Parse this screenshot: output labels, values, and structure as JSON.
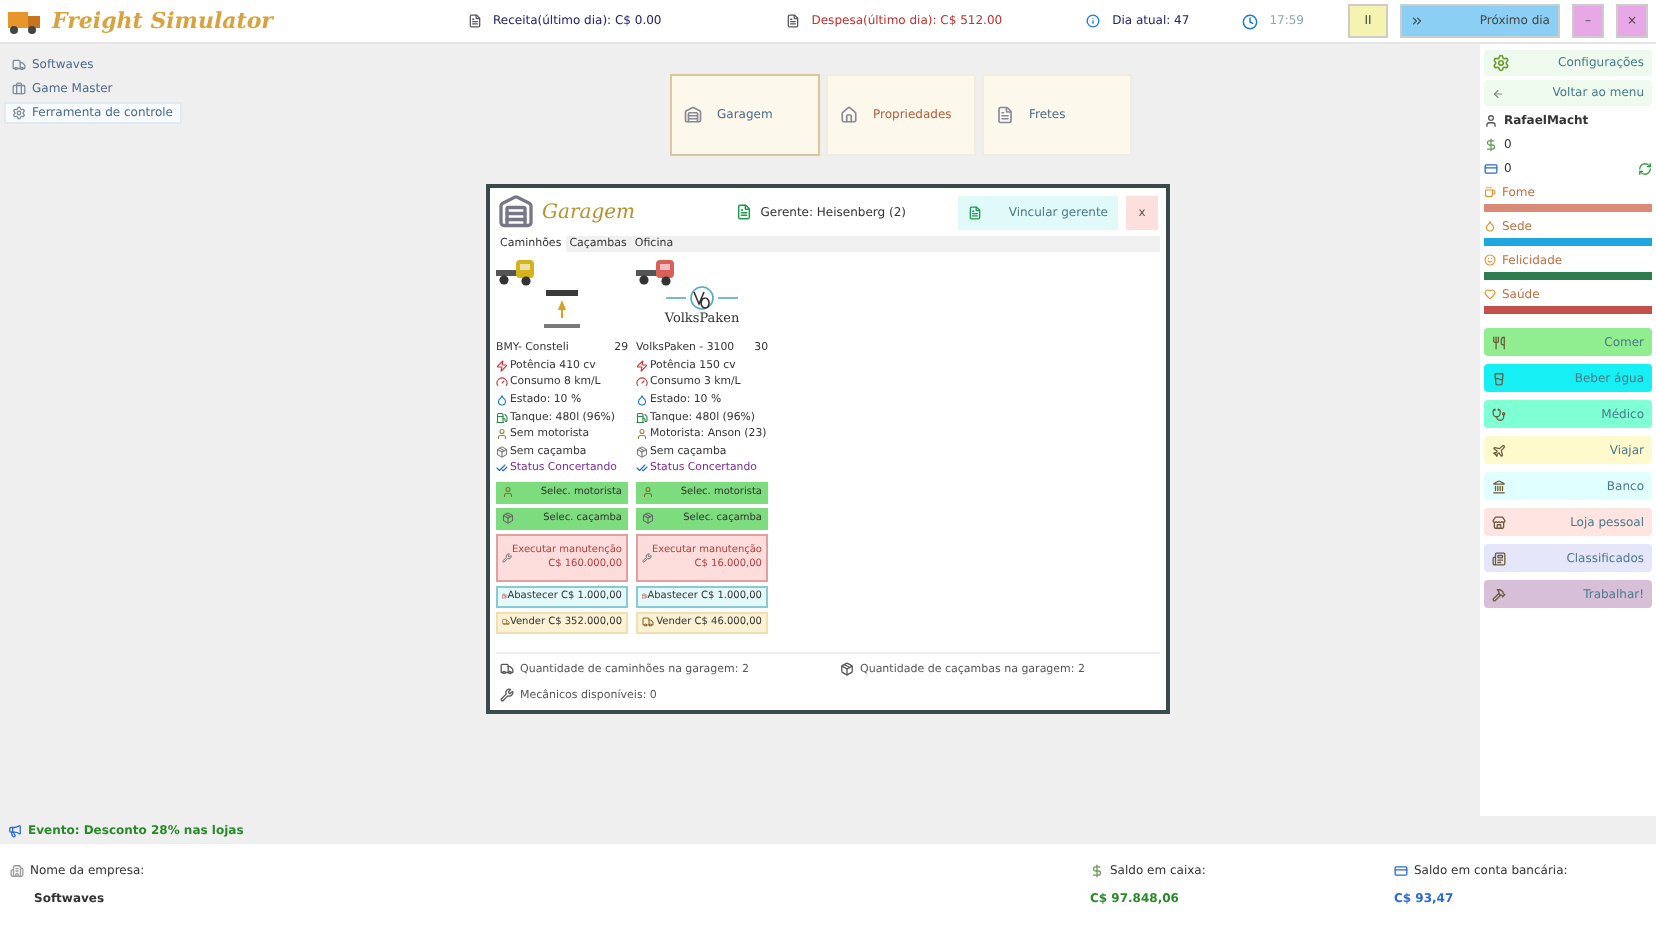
{
  "app": {
    "title": "Freight Simulator"
  },
  "header": {
    "income": "Receita(último dia): C$  0.00",
    "expense": "Despesa(último dia): C$  512.00",
    "day": "Dia atual: 47",
    "time": "17:59",
    "buttons": [
      {
        "kind": "pause",
        "label": "II"
      },
      {
        "kind": "next",
        "label": "Próximo dia"
      },
      {
        "kind": "minimize",
        "label": "–"
      },
      {
        "kind": "close",
        "label": "×"
      }
    ]
  },
  "sidebar": {
    "items": [
      {
        "kind": "truck",
        "label": "Softwaves",
        "selected": false
      },
      {
        "kind": "briefcase",
        "label": "Game Master",
        "selected": false
      },
      {
        "kind": "gear",
        "label": "Ferramenta de controle",
        "selected": true
      }
    ]
  },
  "tiles": [
    {
      "kind": "garage",
      "label": "Garagem",
      "selected": true
    },
    {
      "kind": "property",
      "label": "Propriedades",
      "selected": false
    },
    {
      "kind": "freight",
      "label": "Fretes",
      "selected": false
    }
  ],
  "garage_dialog": {
    "title": "Garagem",
    "manager": "Gerente: Heisenberg (2)",
    "link_button": "Vincular gerente",
    "close": "x",
    "tabs": [
      {
        "label": "Caminhões",
        "selected": true
      },
      {
        "label": "Caçambas",
        "selected": false
      },
      {
        "label": "Oficina",
        "selected": false
      }
    ],
    "trucks": [
      {
        "kind": "emblem",
        "name": "BMY- Consteli",
        "number": "29",
        "power": "Potência 410 cv",
        "consumption": "Consumo 8 km/L",
        "condition": "Estado: 10 %",
        "tank": "Tanque: 480l (96%)",
        "driver": "Sem motorista",
        "trailer": "Sem caçamba",
        "status": "Status Concertando",
        "driver_button": "Selec. motorista",
        "trailer_button": "Selec. caçamba",
        "maintenance_button": [
          "Executar manutenção",
          "C$ 160.000,00"
        ],
        "fuel_button": "Abastecer C$ 1.000,00",
        "sell_button": "Vender C$ 352.000,00"
      },
      {
        "kind": "wordmark",
        "brand_logo": "VolksPaken",
        "name": "VolksPaken - 3100",
        "number": "30",
        "power": "Potência 150 cv",
        "consumption": "Consumo 3 km/L",
        "condition": "Estado: 10 %",
        "tank": "Tanque: 480l (96%)",
        "driver": "Motorista: Anson (23)",
        "trailer": "Sem caçamba",
        "status": "Status Concertando",
        "driver_button": "Selec. motorista",
        "trailer_button": "Selec. caçamba",
        "maintenance_button": [
          "Executar manutenção",
          "C$ 16.000,00"
        ],
        "fuel_button": "Abastecer C$ 1.000,00",
        "sell_button": "Vender C$ 46.000,00"
      }
    ],
    "trucks_count": "Quantidade de caminhões na garagem: 2",
    "trailers_count": "Quantidade de caçambas na garagem: 2",
    "mechanics": "Mecânicos disponíveis: 0"
  },
  "player": {
    "settings": "Configurações",
    "back": "Voltar ao menu",
    "name": "RafaelMacht",
    "cash": "0",
    "bank": "0",
    "needs": [
      {
        "label": "Fome",
        "level": 1,
        "color": "#d98b76"
      },
      {
        "label": "Sede",
        "level": 1,
        "color": "#1fa6e0"
      },
      {
        "label": "Felicidade",
        "level": 1,
        "color": "#2e7b4e"
      },
      {
        "label": "Saúde",
        "level": 1,
        "color": "#c2504c"
      }
    ],
    "actions": [
      {
        "kind": "eat",
        "label": "Comer",
        "color": "#90ee90"
      },
      {
        "kind": "drink",
        "label": "Beber água",
        "color": "#16f0f4"
      },
      {
        "kind": "doctor",
        "label": "Médico",
        "color": "#7fffd4"
      },
      {
        "kind": "travel",
        "label": "Viajar",
        "color": "#fffacd"
      },
      {
        "kind": "bank",
        "label": "Banco",
        "color": "#e0ffff"
      },
      {
        "kind": "shop",
        "label": "Loja pessoal",
        "color": "#ffe4e1"
      },
      {
        "kind": "ads",
        "label": "Classificados",
        "color": "#e6e6fa"
      },
      {
        "kind": "work",
        "label": "Trabalhar!",
        "color": "#d8bfd8"
      }
    ]
  },
  "event": "Evento: Desconto 28% nas lojas",
  "footer": {
    "company_label": "Nome da empresa:",
    "company": "Softwaves",
    "cash_label": "Saldo em caixa:",
    "cash": "C$  97.848,06",
    "bank_label": "Saldo em conta bancária:",
    "bank": "C$  93,47"
  }
}
